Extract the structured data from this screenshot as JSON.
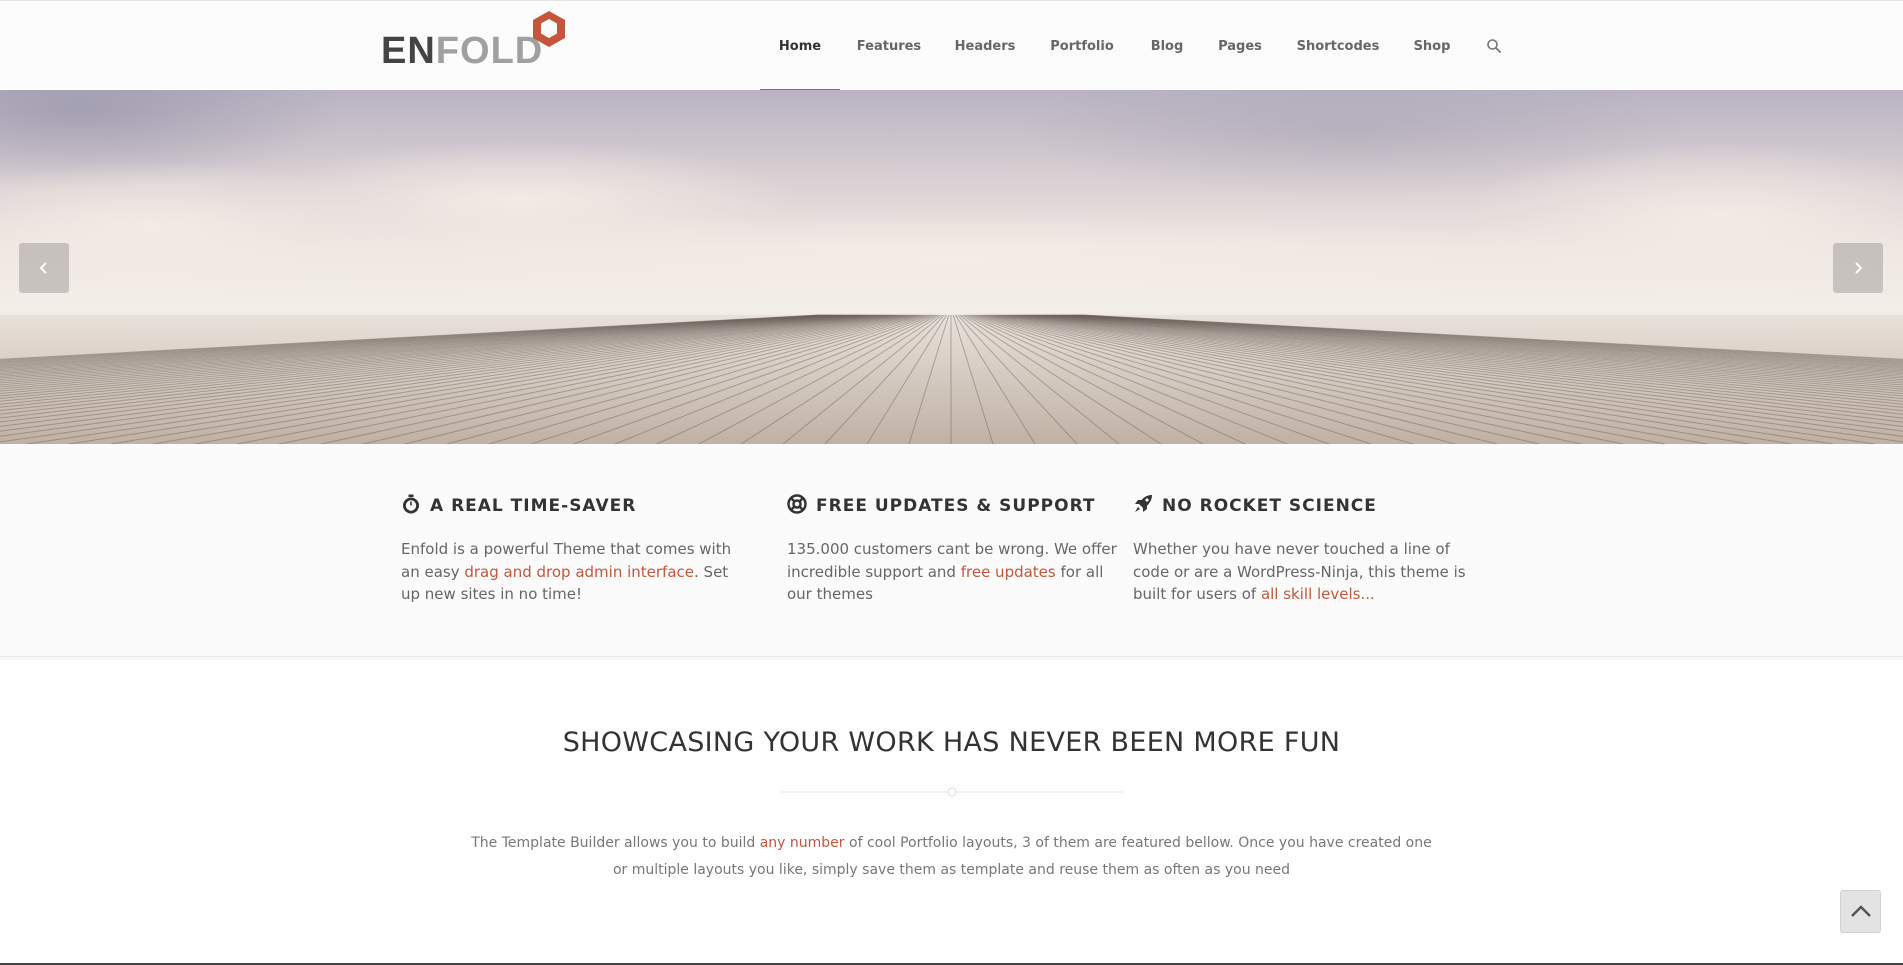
{
  "header": {
    "logo": {
      "part1": "EN",
      "part2": "FOLD",
      "brand_color": "#c4573b"
    },
    "nav": [
      {
        "label": "Home",
        "active": true
      },
      {
        "label": "Features"
      },
      {
        "label": "Headers"
      },
      {
        "label": "Portfolio"
      },
      {
        "label": "Blog"
      },
      {
        "label": "Pages"
      },
      {
        "label": "Shortcodes"
      },
      {
        "label": "Shop"
      }
    ],
    "search_icon": "search-icon"
  },
  "hero": {
    "prev_icon": "chevron-left-icon",
    "next_icon": "chevron-right-icon"
  },
  "features": [
    {
      "icon": "stopwatch-icon",
      "title": "A REAL TIME-SAVER",
      "text_before": "Enfold is a powerful Theme that comes with an easy ",
      "link": "drag and drop admin interface",
      "text_after": ". Set up new sites in no time!"
    },
    {
      "icon": "lifebuoy-icon",
      "title": "FREE UPDATES & SUPPORT",
      "text_before": "135.000 customers cant be wrong. We offer incredible support and ",
      "link": "free updates",
      "text_after": " for all our themes"
    },
    {
      "icon": "rocket-icon",
      "title": "NO ROCKET SCIENCE",
      "text_before": "Whether you have never touched a line of code or are a WordPress-Ninja, this theme is built for users of ",
      "link": "all skill levels...",
      "text_after": ""
    }
  ],
  "showcase": {
    "title": "SHOWCASING YOUR WORK HAS NEVER BEEN MORE FUN",
    "text_before": "The Template Builder allows you to build ",
    "link": "any number",
    "text_after": " of cool Portfolio layouts, 3 of them are featured bellow. Once you have created one or multiple layouts you like, simply save them as template and reuse them as often as you need"
  },
  "scroll_top_icon": "chevron-up-icon",
  "colors": {
    "accent": "#c4573b",
    "text": "#666666",
    "heading": "#333333"
  }
}
